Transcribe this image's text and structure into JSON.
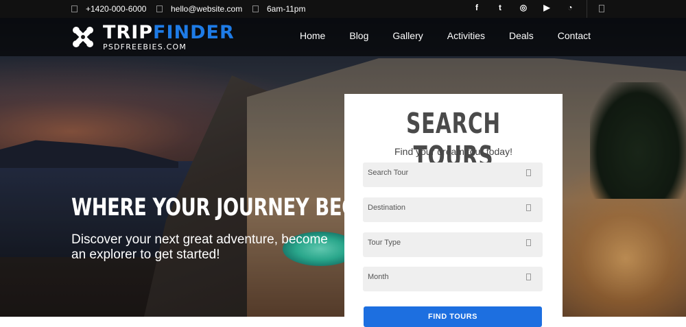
{
  "topbar": {
    "phone": "+1420-000-6000",
    "email": "hello@website.com",
    "hours": "6am-11pm",
    "socials": [
      {
        "icon": "facebook-icon",
        "glyph": "f"
      },
      {
        "icon": "twitter-icon",
        "glyph": "t"
      },
      {
        "icon": "instagram-icon",
        "glyph": "◎"
      },
      {
        "icon": "youtube-icon",
        "glyph": "▶"
      },
      {
        "icon": "whatsapp-icon",
        "glyph": "◔"
      }
    ]
  },
  "brand": {
    "name_part1": "TRIP",
    "name_part2": "FINDER",
    "sub": "PSDFREEBIES.COM",
    "accent": "#1e7be6"
  },
  "nav": {
    "items": [
      "Home",
      "Blog",
      "Gallery",
      "Activities",
      "Deals",
      "Contact"
    ]
  },
  "hero": {
    "headline": "WHERE YOUR JOURNEY BEGINS.",
    "tagline": "Discover your next great adventure, become an explorer to get started!"
  },
  "search": {
    "title": "SEARCH TOURS",
    "subtitle": "Find your dream tour today!",
    "fields": [
      {
        "label": "Search Tour"
      },
      {
        "label": "Destination"
      },
      {
        "label": "Tour Type"
      },
      {
        "label": "Month"
      }
    ],
    "button": "FIND TOURS",
    "button_color": "#1d6fe0"
  }
}
